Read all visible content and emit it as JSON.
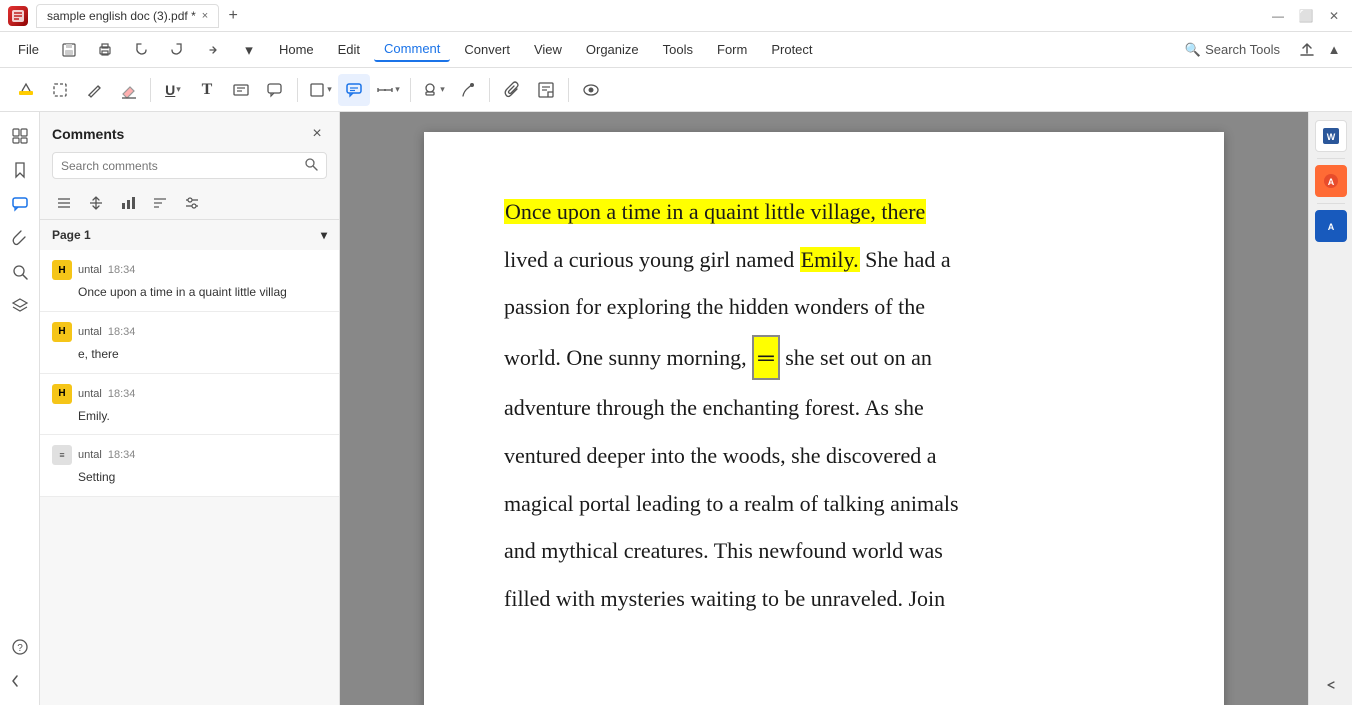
{
  "titlebar": {
    "tab_name": "sample english doc (3).pdf *",
    "close_label": "×",
    "add_tab_label": "+",
    "win_minimize": "—",
    "win_restore": "⬜",
    "win_close": "✕"
  },
  "menubar": {
    "file_label": "File",
    "home_label": "Home",
    "edit_label": "Edit",
    "comment_label": "Comment",
    "convert_label": "Convert",
    "view_label": "View",
    "organize_label": "Organize",
    "tools_label": "Tools",
    "form_label": "Form",
    "protect_label": "Protect",
    "search_tools_label": "Search Tools"
  },
  "toolbar": {
    "highlight_label": "🖍",
    "selection_label": "⬜",
    "pencil_label": "✏",
    "eraser_label": "◻",
    "underline_label": "U",
    "text_label": "T",
    "textbox_label": "⊞",
    "callout_label": "⬡",
    "shape_label": "⬜",
    "comment_label": "💬",
    "measure_label": "📏",
    "stamp_label": "✦",
    "pen_label": "🖊",
    "attachment_label": "📎",
    "sticky_label": "📝",
    "eye_label": "👁"
  },
  "comments_panel": {
    "title": "Comments",
    "close_label": "×",
    "search_placeholder": "Search comments",
    "page1_label": "Page 1",
    "comments": [
      {
        "avatar": "H",
        "author": "untal",
        "time": "18:34",
        "text": "Once upon a time in a quaint little villag",
        "type": "highlight"
      },
      {
        "avatar": "H",
        "author": "untal",
        "time": "18:34",
        "text": "e, there",
        "type": "highlight"
      },
      {
        "avatar": "H",
        "author": "untal",
        "time": "18:34",
        "text": "Emily.",
        "type": "highlight"
      },
      {
        "avatar": "≡",
        "author": "untal",
        "time": "18:34",
        "text": "Setting",
        "type": "note"
      }
    ]
  },
  "pdf": {
    "text_line1": "Once upon a time in a quaint little village, there",
    "text_line2": "lived a curious young girl named ",
    "text_emily": "Emily.",
    "text_line2b": " She had a",
    "text_line3": "passion for exploring the hidden wonders of the",
    "text_line4": "world. One sunny morning, she set out on an",
    "text_line5": "adventure through the enchanting forest. As she",
    "text_line6": "ventured deeper into the woods, she discovered a",
    "text_line7": "magical portal leading to a realm of talking animals",
    "text_line8": "and mythical creatures. This newfound world was",
    "text_line9": "filled with mysteries waiting to be unraveled. Join"
  },
  "right_sidebar": {
    "w_label": "W",
    "a_label": "A",
    "az_label": "A"
  },
  "colors": {
    "accent_blue": "#1a73e8",
    "highlight_yellow": "#ffff00",
    "avatar_yellow": "#f5c518"
  }
}
